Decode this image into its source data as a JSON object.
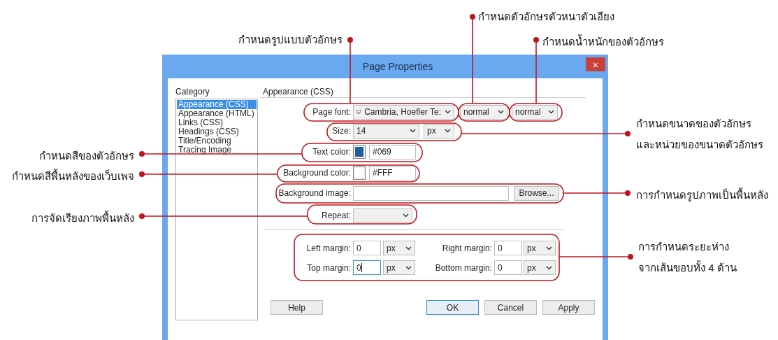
{
  "dialog": {
    "title": "Page Properties",
    "close": "×",
    "category_label": "Category",
    "categories": [
      {
        "label": "Appearance (CSS)",
        "selected": true
      },
      {
        "label": "Appearance (HTML)",
        "selected": false
      },
      {
        "label": "Links (CSS)",
        "selected": false
      },
      {
        "label": "Headings (CSS)",
        "selected": false
      },
      {
        "label": "Title/Encoding",
        "selected": false
      },
      {
        "label": "Tracing Image",
        "selected": false
      }
    ],
    "section_title": "Appearance (CSS)",
    "page_font": {
      "label": "Page font:",
      "value": "Cambria, Hoefler Te:",
      "style": "normal",
      "weight": "normal"
    },
    "size": {
      "label": "Size:",
      "value": "14",
      "unit": "px"
    },
    "text_color": {
      "label": "Text color:",
      "color": "#1f5f9a",
      "value": "#069"
    },
    "background_color": {
      "label": "Background color:",
      "color": "#ffffff",
      "value": "#FFF"
    },
    "background_image": {
      "label": "Background image:",
      "button": "Browse..."
    },
    "repeat": {
      "label": "Repeat:"
    },
    "margins": [
      {
        "label": "Left margin:",
        "value": "0",
        "unit": "px",
        "focused": false
      },
      {
        "label": "Right margin:",
        "value": "0",
        "unit": "px",
        "focused": false
      },
      {
        "label": "Top margin:",
        "value": "0",
        "unit": "px",
        "focused": true
      },
      {
        "label": "Bottom margin:",
        "value": "0",
        "unit": "px",
        "focused": false
      }
    ],
    "buttons": [
      "Help",
      "OK",
      "Cancel",
      "Apply"
    ]
  },
  "annotations": [
    {
      "lines": [
        "กำหนดรูปแบบตัวอักษร"
      ]
    },
    {
      "lines": [
        "กำหนดตัวอักษรตัวหนาตัวเอียง"
      ]
    },
    {
      "lines": [
        "กำหนดน้ำหนักของตัวอักษร"
      ]
    },
    {
      "lines": [
        "กำหนดขนาดของตัวอักษร",
        "และหน่วยของขนาดตัวอักษร"
      ]
    },
    {
      "lines": [
        "กำหนดสีของตัวอักษร"
      ]
    },
    {
      "lines": [
        "กำหนดสีพื้นหลังของเว็บเพจ"
      ]
    },
    {
      "lines": [
        "การกำหนดรูปภาพเป็นพื้นหลัง"
      ]
    },
    {
      "lines": [
        "การจัดเรียงภาพพื้นหลัง"
      ]
    },
    {
      "lines": [
        "การกำหนดระยะห่าง",
        "จากเส้นขอบทั้ง 4 ด้าน"
      ]
    }
  ]
}
